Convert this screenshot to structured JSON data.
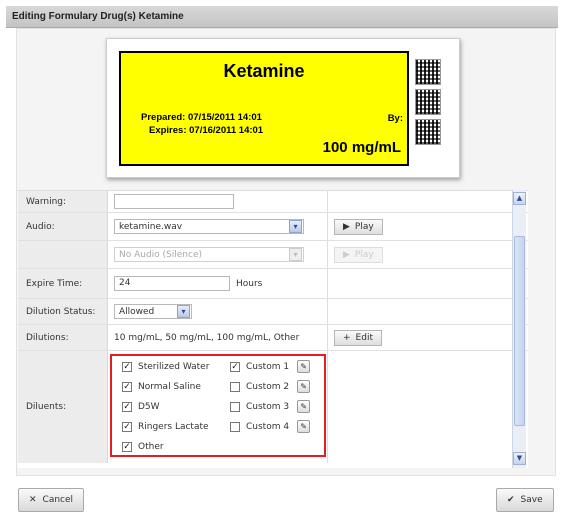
{
  "dialog": {
    "title": "Editing Formulary Drug(s) Ketamine"
  },
  "label": {
    "drug_name": "Ketamine",
    "prepared": "Prepared: 07/15/2011 14:01",
    "expires": "Expires: 07/16/2011 14:01",
    "by": "By:",
    "concentration": "100 mg/mL",
    "label_color": "#ffff00"
  },
  "form": {
    "warning": {
      "label": "Warning:",
      "value": ""
    },
    "audio": {
      "label": "Audio:",
      "selected": "ketamine.wav",
      "play_label": "Play"
    },
    "audio2": {
      "selected": "No Audio (Silence)",
      "play_label": "Play"
    },
    "expire_time": {
      "label": "Expire Time:",
      "value": "24",
      "unit": "Hours"
    },
    "dilution_status": {
      "label": "Dilution Status:",
      "selected": "Allowed"
    },
    "dilutions": {
      "label": "Dilutions:",
      "value": "10 mg/mL, 50 mg/mL, 100 mg/mL, Other",
      "edit_label": "Edit"
    },
    "diluents": {
      "label": "Diluents:",
      "items": [
        {
          "name": "Sterilized Water",
          "checked": true
        },
        {
          "name": "Normal Saline",
          "checked": true
        },
        {
          "name": "D5W",
          "checked": true
        },
        {
          "name": "Ringers Lactate",
          "checked": true
        },
        {
          "name": "Other",
          "checked": true
        }
      ],
      "custom": [
        {
          "name": "Custom 1",
          "checked": true
        },
        {
          "name": "Custom 2",
          "checked": false
        },
        {
          "name": "Custom 3",
          "checked": false
        },
        {
          "name": "Custom 4",
          "checked": false
        }
      ]
    }
  },
  "footer": {
    "cancel_label": "Cancel",
    "save_label": "Save"
  },
  "colors": {
    "highlight_border": "#e02020",
    "accent": "#2d4f8f"
  },
  "icons": {
    "play": "play-icon",
    "plus": "plus-icon",
    "pencil": "pencil-icon",
    "cancel": "x-icon",
    "save": "check-icon"
  }
}
